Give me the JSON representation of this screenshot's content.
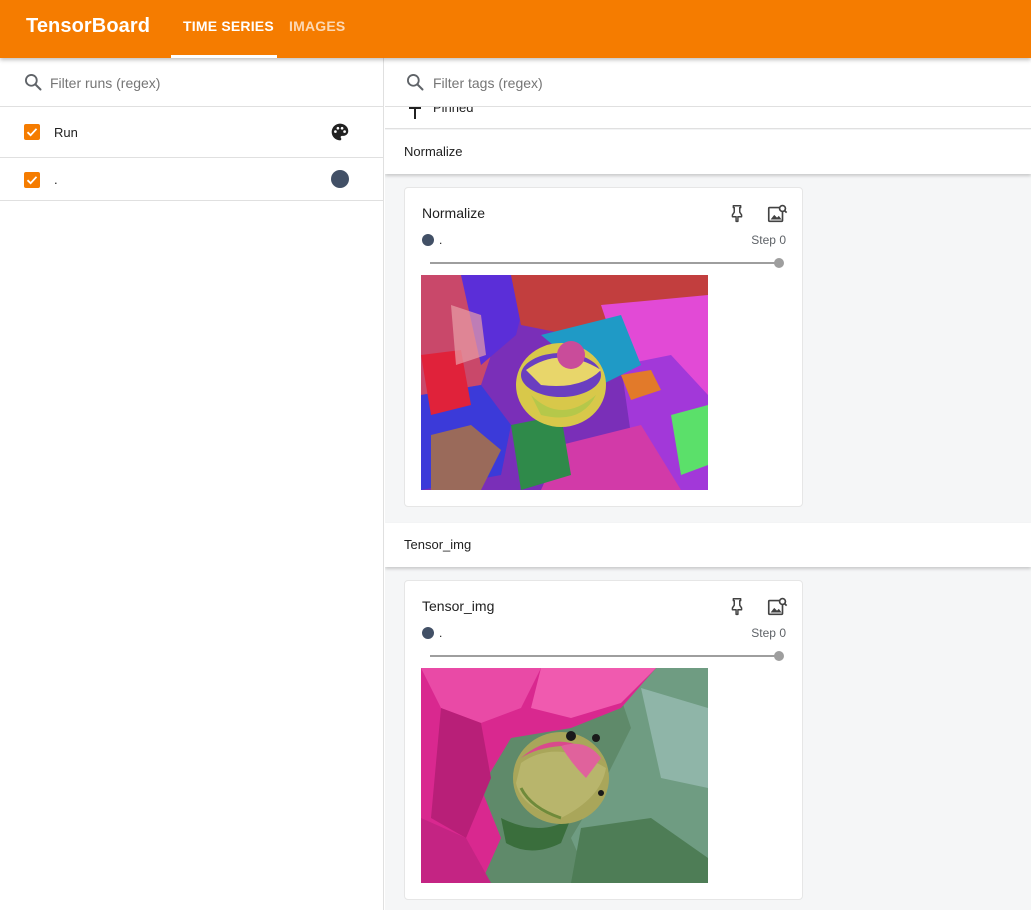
{
  "app": {
    "title": "TensorBoard",
    "tabs": [
      {
        "label": "TIME SERIES",
        "active": true
      },
      {
        "label": "IMAGES",
        "active": false
      }
    ]
  },
  "colors": {
    "brand": "#f57c00",
    "run_color": "#425066"
  },
  "sidebar": {
    "filter_placeholder": "Filter runs (regex)",
    "palette_icon": "palette-icon",
    "runs": [
      {
        "label": "Run",
        "checked": true,
        "header": true
      },
      {
        "label": ".",
        "checked": true
      }
    ]
  },
  "main": {
    "tag_filter_placeholder": "Filter tags (regex)",
    "pinned_label": "Pinned",
    "groups": [
      {
        "title": "Normalize",
        "card": {
          "title": "Normalize",
          "run": ".",
          "step": "Step 0",
          "image": "normalized-peony-bud"
        }
      },
      {
        "title": "Tensor_img",
        "card": {
          "title": "Tensor_img",
          "run": ".",
          "step": "Step 0",
          "image": "peony-bud-photo"
        }
      }
    ]
  }
}
